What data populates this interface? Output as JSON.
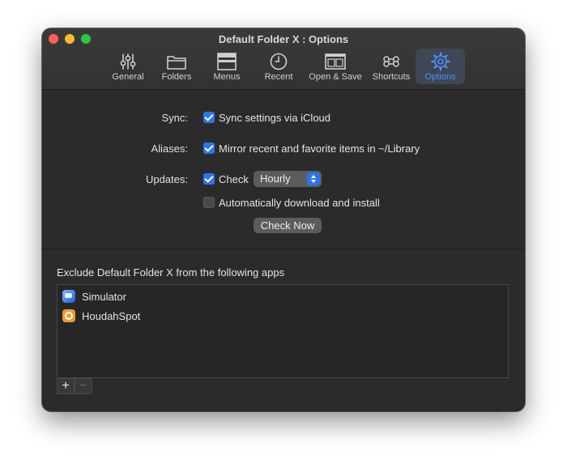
{
  "window": {
    "title": "Default Folder X : Options"
  },
  "tabs": [
    {
      "label": "General",
      "icon": "sliders-icon"
    },
    {
      "label": "Folders",
      "icon": "folder-icon"
    },
    {
      "label": "Menus",
      "icon": "menu-window-icon"
    },
    {
      "label": "Recent",
      "icon": "clock-icon"
    },
    {
      "label": "Open & Save",
      "icon": "window-split-icon"
    },
    {
      "label": "Shortcuts",
      "icon": "command-key-icon"
    },
    {
      "label": "Options",
      "icon": "gear-icon",
      "active": true
    }
  ],
  "settings": {
    "sync_label": "Sync:",
    "sync_text": "Sync settings via iCloud",
    "sync_checked": true,
    "aliases_label": "Aliases:",
    "aliases_text": "Mirror recent and favorite items in ~/Library",
    "aliases_checked": true,
    "updates_label": "Updates:",
    "check_text": "Check",
    "check_checked": true,
    "frequency_selected": "Hourly",
    "auto_text": "Automatically download and install",
    "auto_checked": false,
    "check_now_label": "Check Now"
  },
  "exclude": {
    "title": "Exclude Default Folder X from the following apps",
    "apps": [
      {
        "name": "Simulator",
        "icon": "simulator-app-icon"
      },
      {
        "name": "HoudahSpot",
        "icon": "houdahspot-app-icon"
      }
    ],
    "add_label": "+",
    "remove_label": "−"
  },
  "colors": {
    "accent": "#2a75f0",
    "tab_active_text": "#4a8ff7",
    "window_bg": "#2c2b2b"
  }
}
